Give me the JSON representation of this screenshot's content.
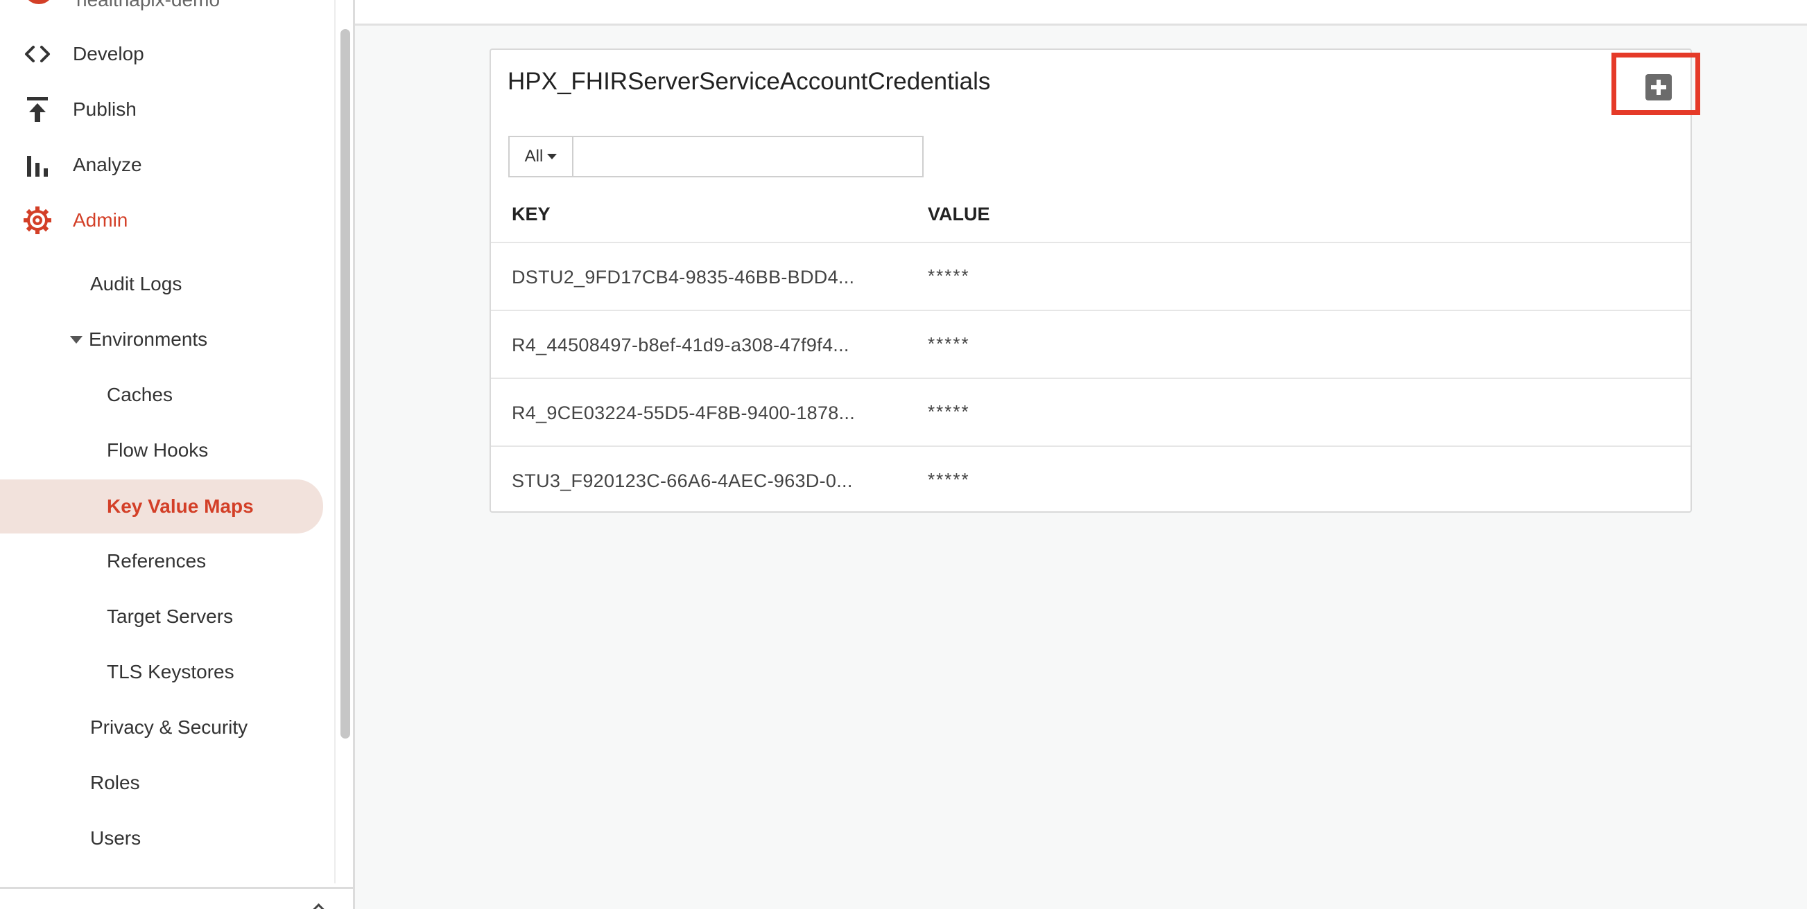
{
  "sidebar": {
    "org_name": "healthapix-demo",
    "main_items": [
      {
        "label": "Develop",
        "icon": "code-icon"
      },
      {
        "label": "Publish",
        "icon": "publish-icon"
      },
      {
        "label": "Analyze",
        "icon": "bar-chart-icon"
      },
      {
        "label": "Admin",
        "icon": "gear-icon"
      }
    ],
    "admin_items": [
      {
        "label": "Audit Logs"
      },
      {
        "label": "Environments"
      },
      {
        "label": "Caches"
      },
      {
        "label": "Flow Hooks"
      },
      {
        "label": "Key Value Maps"
      },
      {
        "label": "References"
      },
      {
        "label": "Target Servers"
      },
      {
        "label": "TLS Keystores"
      },
      {
        "label": "Privacy & Security"
      },
      {
        "label": "Roles"
      },
      {
        "label": "Users"
      }
    ],
    "selected": "Key Value Maps"
  },
  "kvm": {
    "title": "HPX_FHIRServerServiceAccountCredentials",
    "filter": {
      "selected": "All",
      "value": ""
    },
    "columns": {
      "key": "KEY",
      "value": "VALUE"
    },
    "rows": [
      {
        "key": "DSTU2_9FD17CB4-9835-46BB-BDD4...",
        "value": "*****"
      },
      {
        "key": "R4_44508497-b8ef-41d9-a308-47f9f4...",
        "value": "*****"
      },
      {
        "key": "R4_9CE03224-55D5-4F8B-9400-1878...",
        "value": "*****"
      },
      {
        "key": "STU3_F920123C-66A6-4AEC-963D-0...",
        "value": "*****"
      }
    ]
  },
  "colors": {
    "accent": "#d33f27",
    "highlight_box": "#e53a28",
    "selected_bg": "#f2e2dc"
  }
}
